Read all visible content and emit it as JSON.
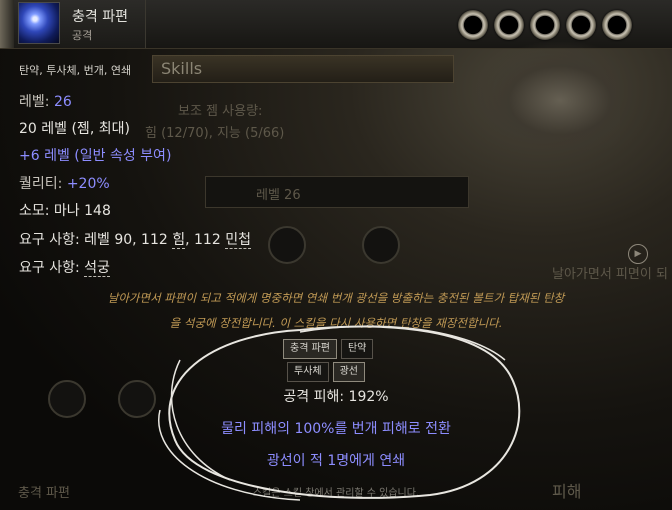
{
  "background": {
    "skills_tab": "Skills",
    "panel_lines": [
      "보조 젬 사용량:",
      "힘 (12/70), 지능 (5/66)",
      "레벨 26",
      "날아가면서 피면이 되",
      "충격 파편"
    ],
    "right_labels": [
      "피해"
    ],
    "level_value": "26"
  },
  "tooltip": {
    "name": "충격 파편",
    "type": "공격",
    "tags": "탄약, 투사체, 번개, 연쇄",
    "level_label": "레벨: ",
    "level_value": "26",
    "gem_level": "20 레벨 (젬, 최대)",
    "bonus_level": "+6 레벨 (일반 속성 부여)",
    "quality_label": "퀄리티: ",
    "quality_value": "+20%",
    "cost": "소모: 마나 148",
    "req1_prefix": "요구 사항: 레벨 90, 112 ",
    "req1_str": "힘",
    "req1_mid": ", 112 ",
    "req1_dex": "민첩",
    "req2_prefix": "요구 사항: ",
    "req2_weapon": "석궁",
    "desc_line1": "날아가면서 파편이 되고 적에게 명중하면 연쇄 번개 광선을 방출하는 충전된 볼트가 탑재된 탄창",
    "desc_line2": "을 석궁에 장전합니다. 이 스킬을 다시 사용하면 탄창을 재장전합니다.",
    "tabs_row1": [
      "충격 파편",
      "탄약"
    ],
    "tabs_row2": [
      "투사체",
      "광선"
    ],
    "attack_damage": "공격 피해: 192%",
    "convert": "물리 피해의 100%를 번개 피해로 전환",
    "chain": "광선이 적 1명에게 연쇄",
    "footer": "스킬은 스킬 창에서 관리할 수 있습니다."
  },
  "colors": {
    "magic_blue": "#8d8dff",
    "white_text": "#e6e4df",
    "flavor_gold": "#c19a55"
  },
  "icons": [
    "shock-bolt-gem-icon",
    "socket-icon",
    "play-icon"
  ]
}
